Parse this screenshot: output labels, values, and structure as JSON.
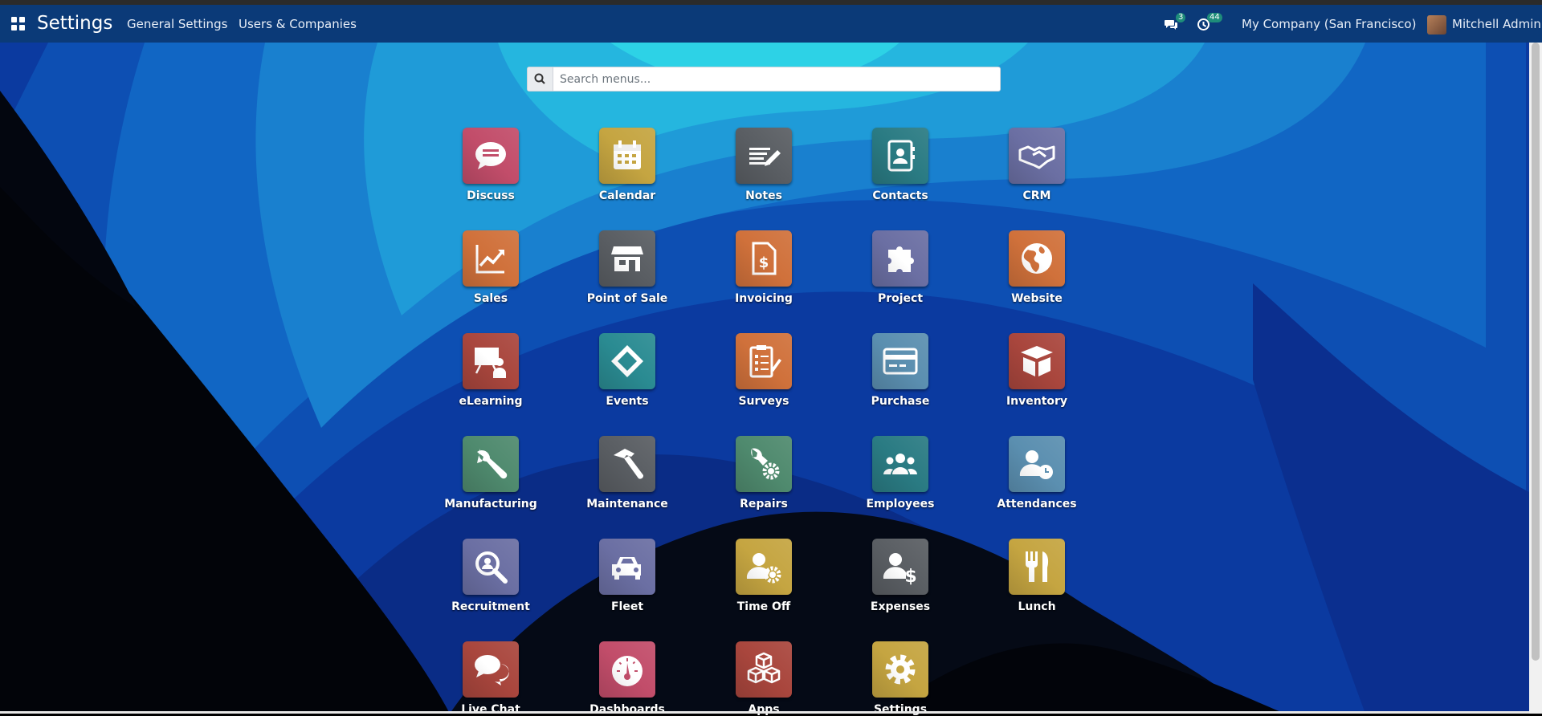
{
  "navbar": {
    "title": "Settings",
    "links": [
      "General Settings",
      "Users & Companies"
    ],
    "messages_count": "3",
    "activities_count": "44",
    "company": "My Company (San Francisco)",
    "user": "Mitchell Admin"
  },
  "search": {
    "placeholder": "Search menus..."
  },
  "apps": [
    {
      "label": "Discuss",
      "icon": "chat-icon",
      "color": "#c24d6a"
    },
    {
      "label": "Calendar",
      "icon": "calendar-icon",
      "color": "#c5a541"
    },
    {
      "label": "Notes",
      "icon": "notes-icon",
      "color": "#5a5e63"
    },
    {
      "label": "Contacts",
      "icon": "contact-book-icon",
      "color": "#2a7b83"
    },
    {
      "label": "CRM",
      "icon": "handshake-icon",
      "color": "#6b6fa3"
    },
    {
      "label": "Sales",
      "icon": "chart-line-icon",
      "color": "#d0713b"
    },
    {
      "label": "Point of Sale",
      "icon": "store-icon",
      "color": "#5a5e63"
    },
    {
      "label": "Invoicing",
      "icon": "invoice-icon",
      "color": "#d0713b"
    },
    {
      "label": "Project",
      "icon": "puzzle-icon",
      "color": "#6b6fa3"
    },
    {
      "label": "Website",
      "icon": "globe-icon",
      "color": "#d0713b"
    },
    {
      "label": "eLearning",
      "icon": "teacher-icon",
      "color": "#a9463d"
    },
    {
      "label": "Events",
      "icon": "ticket-icon",
      "color": "#2a8b92"
    },
    {
      "label": "Surveys",
      "icon": "survey-clipboard-icon",
      "color": "#d0713b"
    },
    {
      "label": "Purchase",
      "icon": "credit-card-icon",
      "color": "#5b8fb0"
    },
    {
      "label": "Inventory",
      "icon": "box-icon",
      "color": "#a9463d"
    },
    {
      "label": "Manufacturing",
      "icon": "wrench-icon",
      "color": "#4f8a6e"
    },
    {
      "label": "Maintenance",
      "icon": "hammer-icon",
      "color": "#5a5e63"
    },
    {
      "label": "Repairs",
      "icon": "wrench-gear-icon",
      "color": "#4f8a6e"
    },
    {
      "label": "Employees",
      "icon": "users-icon",
      "color": "#2a7b83"
    },
    {
      "label": "Attendances",
      "icon": "user-clock-icon",
      "color": "#5b8fb0"
    },
    {
      "label": "Recruitment",
      "icon": "magnifier-icon",
      "color": "#6b6fa3"
    },
    {
      "label": "Fleet",
      "icon": "car-icon",
      "color": "#6b6fa3"
    },
    {
      "label": "Time Off",
      "icon": "user-gear-icon",
      "color": "#c5a541"
    },
    {
      "label": "Expenses",
      "icon": "user-dollar-icon",
      "color": "#5a5e63"
    },
    {
      "label": "Lunch",
      "icon": "cutlery-icon",
      "color": "#c5a541"
    },
    {
      "label": "Live Chat",
      "icon": "chat-bubbles-icon",
      "color": "#a9463d"
    },
    {
      "label": "Dashboards",
      "icon": "gauge-icon",
      "color": "#c24d6a"
    },
    {
      "label": "Apps",
      "icon": "cubes-icon",
      "color": "#a9463d"
    },
    {
      "label": "Settings",
      "icon": "gear-icon",
      "color": "#c5a541"
    }
  ]
}
